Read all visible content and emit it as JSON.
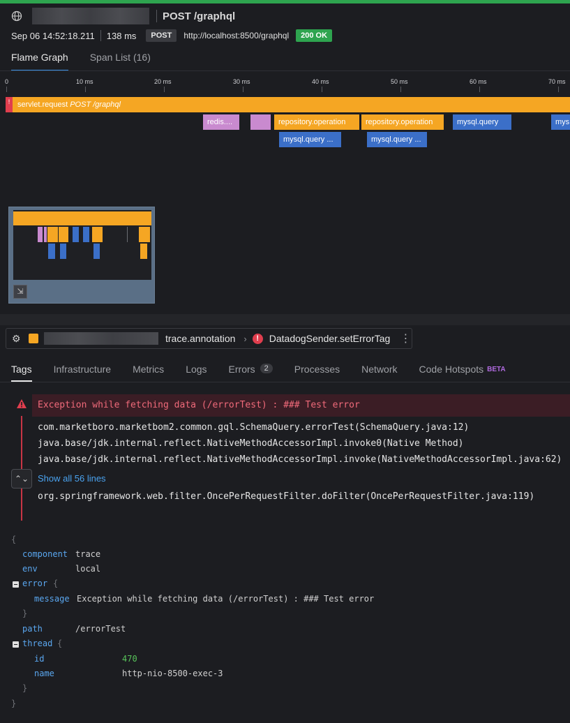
{
  "header": {
    "title": "POST /graphql",
    "timestamp": "Sep 06 14:52:18.211",
    "duration": "138 ms",
    "method": "POST",
    "url": "http://localhost:8500/graphql",
    "status": "200 OK"
  },
  "top_tabs": [
    {
      "label": "Flame Graph"
    },
    {
      "label": "Span List (16)"
    }
  ],
  "axis_ticks": [
    "0",
    "10 ms",
    "20 ms",
    "30 ms",
    "40 ms",
    "50 ms",
    "60 ms",
    "70 ms"
  ],
  "spans": {
    "root": {
      "name": "servlet.request",
      "resource": "POST /graphql",
      "marker": "!"
    },
    "redis": "redis....",
    "repo1": "repository.operation",
    "repo2": "repository.operation",
    "mysql1": "mysql.query",
    "mysql2": "mys",
    "mysql_child1": "mysql.query ...",
    "mysql_child2": "mysql.query ..."
  },
  "breadcrumb": {
    "service": "trace.annotation",
    "span": "DatadogSender.setErrorTag"
  },
  "detail_tabs": [
    {
      "label": "Tags"
    },
    {
      "label": "Infrastructure"
    },
    {
      "label": "Metrics"
    },
    {
      "label": "Logs"
    },
    {
      "label": "Errors",
      "count": "2"
    },
    {
      "label": "Processes"
    },
    {
      "label": "Network"
    },
    {
      "label": "Code Hotspots",
      "badge": "BETA"
    }
  ],
  "error": {
    "message": "Exception while fetching data (/errorTest) : ### Test error",
    "stack": [
      "com.marketboro.marketbom2.common.gql.SchemaQuery.errorTest(SchemaQuery.java:12)",
      "java.base/jdk.internal.reflect.NativeMethodAccessorImpl.invoke0(Native Method)",
      "java.base/jdk.internal.reflect.NativeMethodAccessorImpl.invoke(NativeMethodAccessorImpl.java:62)"
    ],
    "show_all": "Show all 56 lines",
    "last_line": "org.springframework.web.filter.OncePerRequestFilter.doFilter(OncePerRequestFilter.java:119)"
  },
  "tags": {
    "open": "{",
    "close": "}",
    "component_key": "component",
    "component_val": "trace",
    "env_key": "env",
    "env_val": "local",
    "error_key": "error",
    "error_open": "{",
    "message_key": "message",
    "message_val": "Exception while fetching data (/errorTest) : ### Test error",
    "error_close": "}",
    "path_key": "path",
    "path_val": "/errorTest",
    "thread_key": "thread",
    "thread_open": "{",
    "id_key": "id",
    "id_val": "470",
    "name_key": "name",
    "name_val": "http-nio-8500-exec-3",
    "thread_close": "}"
  },
  "colors": {
    "accent_green": "#2ea44f",
    "span_orange": "#f5a623",
    "span_pink": "#c98acf",
    "span_blue": "#3b6fc8",
    "error_red": "#e03e4e"
  }
}
